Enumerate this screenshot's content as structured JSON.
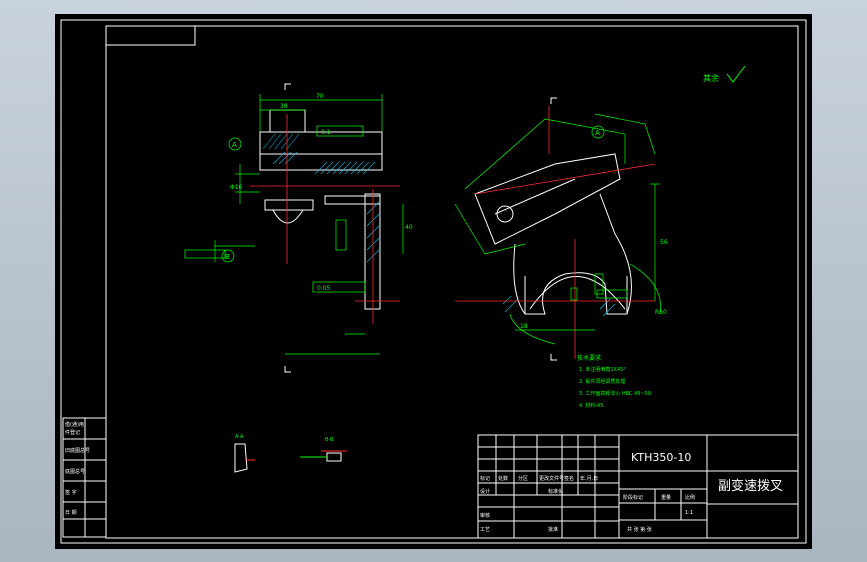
{
  "drawing": {
    "part_name": "副变速拨叉",
    "drawing_number": "KTH350-10",
    "scale": "1:1",
    "roughness_note": "其余"
  },
  "tech_requirements": {
    "title": "技术要求",
    "items": [
      "1. 未注明倒角1X45°",
      "2. 锻件须经调质处理",
      "3. 工作面高频淬火 HRC 45~50",
      "4. 材料:45"
    ]
  },
  "title_block": {
    "cols": [
      "标记",
      "处数",
      "分区",
      "更改文件号",
      "签名",
      "年.月.日"
    ],
    "rows": [
      "设计",
      "审核",
      "工艺"
    ],
    "std_label": "标准化",
    "approve_label": "批准",
    "stage_label": "阶段标记",
    "weight_label": "重量",
    "scale_label": "比例",
    "sheet_label": "共   张   第   张"
  },
  "side_table": [
    "借(通)用",
    "件登记",
    "旧底图总号",
    "底图总号",
    "签 字",
    "日 期"
  ],
  "sections": [
    "A-A",
    "B-B"
  ],
  "labels": {
    "datum_a": "A",
    "datum_b": "B",
    "dim_top": "70",
    "dim_width": "38",
    "dim_bore": "Φ16",
    "dim_h1": "40",
    "dim_h2": "56",
    "dim_r": "R60",
    "dim_slot": "18",
    "tol_1": "0.1",
    "tol_2": "0.05"
  }
}
